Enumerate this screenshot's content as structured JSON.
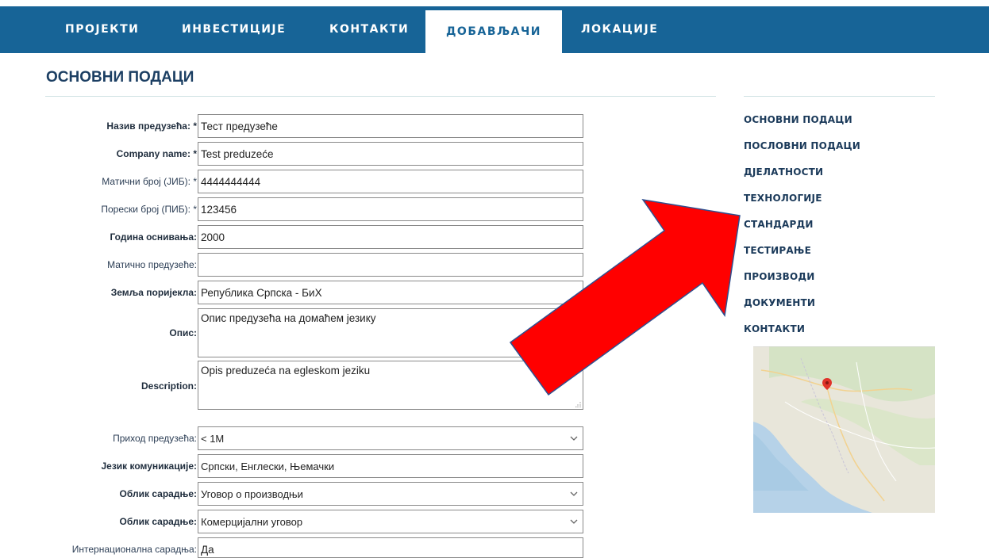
{
  "nav": {
    "tabs": [
      {
        "label": "ПРОЈЕКТИ"
      },
      {
        "label": "ИНВЕСТИЦИЈЕ"
      },
      {
        "label": "КОНТАКТИ"
      },
      {
        "label": "ДОБАВЉАЧИ",
        "active": true
      },
      {
        "label": "ЛОКАЦИЈЕ"
      }
    ]
  },
  "page": {
    "title": "ОСНОВНИ ПОДАЦИ"
  },
  "form": {
    "company_name_local": {
      "label": "Назив предузећа:",
      "required": "*",
      "value": "Тест предузеће"
    },
    "company_name": {
      "label": "Company name:",
      "required": "*",
      "value": "Test preduzeće"
    },
    "jib": {
      "label": "Матични број (ЈИБ):",
      "required": "*",
      "value": "4444444444"
    },
    "pib": {
      "label": "Порески број (ПИБ):",
      "required": "*",
      "value": "123456"
    },
    "founded": {
      "label": "Година оснивања:",
      "value": "2000"
    },
    "parent_company": {
      "label": "Матично предузеће:",
      "value": ""
    },
    "country": {
      "label": "Земља поријекла:",
      "value": "Република Српска - БиХ"
    },
    "description_local": {
      "label": "Опис:",
      "value": "Опис предузећа на домаћем језику"
    },
    "description": {
      "label": "Description:",
      "value": "Opis preduzeća na egleskom jeziku"
    },
    "revenue": {
      "label": "Приход предузећа:",
      "value": "< 1M"
    },
    "languages": {
      "label": "Језик комуникације:",
      "value": "Српски, Енглески, Њемачки"
    },
    "cooperation_form_1": {
      "label": "Облик сарадње:",
      "value": "Уговор о производњи"
    },
    "cooperation_form_2": {
      "label": "Облик сарадње:",
      "value": "Комерцијални уговор"
    },
    "international": {
      "label": "Интернационална сарадња:",
      "value": "Да"
    }
  },
  "sidebar": {
    "items": [
      {
        "label": "ОСНОВНИ ПОДАЦИ"
      },
      {
        "label": "ПОСЛОВНИ ПОДАЦИ"
      },
      {
        "label": "ДЈЕЛАТНОСТИ"
      },
      {
        "label": "ТЕХНОЛОГИЈЕ"
      },
      {
        "label": "СТАНДАРДИ"
      },
      {
        "label": "ТЕСТИРАЊЕ"
      },
      {
        "label": "ПРОИЗВОДИ"
      },
      {
        "label": "ДОКУМЕНТИ"
      },
      {
        "label": "КОНТАКТИ"
      }
    ]
  },
  "colors": {
    "nav_bg": "#176497",
    "title": "#1c3f63",
    "arrow": "#ff0000",
    "arrow_outline": "#2f4f8f"
  },
  "icons": {
    "select": "chevron-down-icon",
    "resize": "resize-grip-icon",
    "map_pin": "map-pin-icon"
  }
}
